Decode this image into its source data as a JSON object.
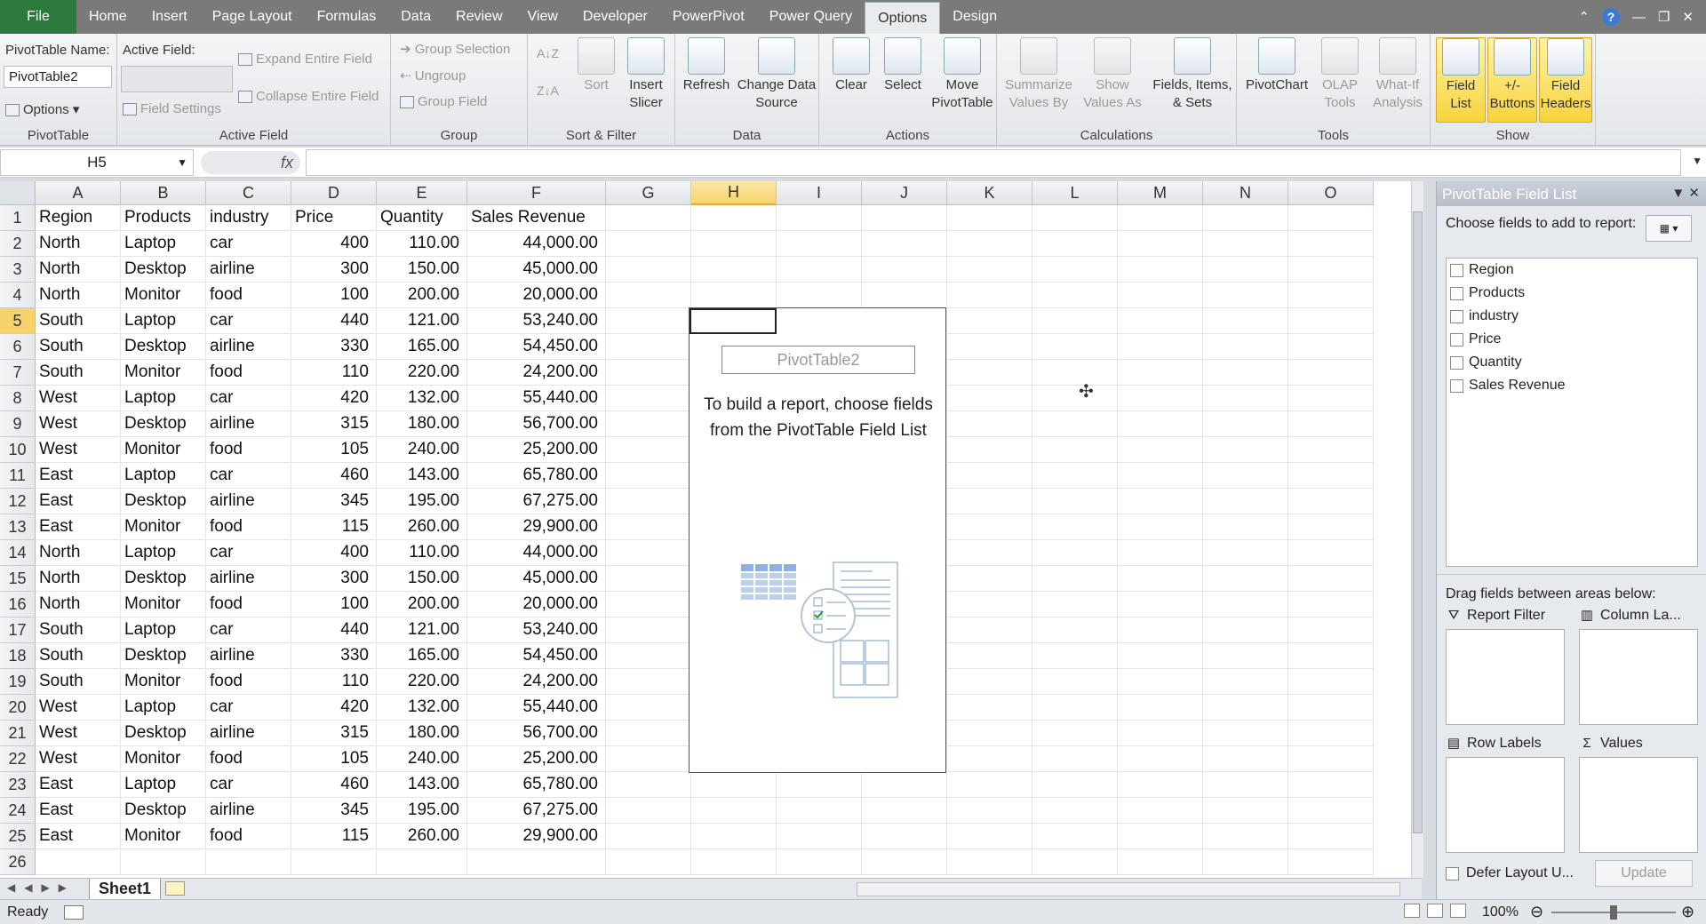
{
  "tabs": {
    "file": "File",
    "items": [
      "Home",
      "Insert",
      "Page Layout",
      "Formulas",
      "Data",
      "Review",
      "View",
      "Developer",
      "PowerPivot",
      "Power Query",
      "Options",
      "Design"
    ],
    "active": "Options"
  },
  "ribbon": {
    "pivottable": {
      "name_label": "PivotTable Name:",
      "name_value": "PivotTable2",
      "options_label": "Options",
      "group_label": "PivotTable"
    },
    "active_field": {
      "label": "Active Field:",
      "field_settings": "Field Settings",
      "expand": "Expand Entire Field",
      "collapse": "Collapse Entire Field",
      "group_label": "Active Field"
    },
    "group": {
      "group_selection": "Group Selection",
      "ungroup": "Ungroup",
      "group_field": "Group Field",
      "group_label": "Group"
    },
    "sort_filter": {
      "sort": "Sort",
      "insert_slicer": "Insert Slicer",
      "group_label": "Sort & Filter"
    },
    "data": {
      "refresh": "Refresh",
      "change_source": "Change Data Source",
      "group_label": "Data"
    },
    "actions": {
      "clear": "Clear",
      "select": "Select",
      "move": "Move PivotTable",
      "group_label": "Actions"
    },
    "calculations": {
      "summarize": "Summarize Values By",
      "show_values": "Show Values As",
      "fields_items": "Fields, Items, & Sets",
      "group_label": "Calculations"
    },
    "tools": {
      "pivotchart": "PivotChart",
      "olap": "OLAP Tools",
      "whatif": "What-If Analysis",
      "group_label": "Tools"
    },
    "show": {
      "field_list": "Field List",
      "buttons": "+/- Buttons",
      "headers": "Field Headers",
      "group_label": "Show"
    }
  },
  "formula_bar": {
    "name_box": "H5",
    "fx": "fx",
    "value": ""
  },
  "grid": {
    "columns": [
      "A",
      "B",
      "C",
      "D",
      "E",
      "F",
      "G",
      "H",
      "I",
      "J",
      "K",
      "L",
      "M",
      "N",
      "O"
    ],
    "selected_column": "H",
    "selected_row": 5,
    "header": [
      "Region",
      "Products",
      "industry",
      "Price",
      "Quantity",
      "Sales Revenue"
    ],
    "rows": [
      [
        "North",
        "Laptop",
        "car",
        "400",
        "110.00",
        "44,000.00"
      ],
      [
        "North",
        "Desktop",
        "airline",
        "300",
        "150.00",
        "45,000.00"
      ],
      [
        "North",
        "Monitor",
        "food",
        "100",
        "200.00",
        "20,000.00"
      ],
      [
        "South",
        "Laptop",
        "car",
        "440",
        "121.00",
        "53,240.00"
      ],
      [
        "South",
        "Desktop",
        "airline",
        "330",
        "165.00",
        "54,450.00"
      ],
      [
        "South",
        "Monitor",
        "food",
        "110",
        "220.00",
        "24,200.00"
      ],
      [
        "West",
        "Laptop",
        "car",
        "420",
        "132.00",
        "55,440.00"
      ],
      [
        "West",
        "Desktop",
        "airline",
        "315",
        "180.00",
        "56,700.00"
      ],
      [
        "West",
        "Monitor",
        "food",
        "105",
        "240.00",
        "25,200.00"
      ],
      [
        "East",
        "Laptop",
        "car",
        "460",
        "143.00",
        "65,780.00"
      ],
      [
        "East",
        "Desktop",
        "airline",
        "345",
        "195.00",
        "67,275.00"
      ],
      [
        "East",
        "Monitor",
        "food",
        "115",
        "260.00",
        "29,900.00"
      ],
      [
        "North",
        "Laptop",
        "car",
        "400",
        "110.00",
        "44,000.00"
      ],
      [
        "North",
        "Desktop",
        "airline",
        "300",
        "150.00",
        "45,000.00"
      ],
      [
        "North",
        "Monitor",
        "food",
        "100",
        "200.00",
        "20,000.00"
      ],
      [
        "South",
        "Laptop",
        "car",
        "440",
        "121.00",
        "53,240.00"
      ],
      [
        "South",
        "Desktop",
        "airline",
        "330",
        "165.00",
        "54,450.00"
      ],
      [
        "South",
        "Monitor",
        "food",
        "110",
        "220.00",
        "24,200.00"
      ],
      [
        "West",
        "Laptop",
        "car",
        "420",
        "132.00",
        "55,440.00"
      ],
      [
        "West",
        "Desktop",
        "airline",
        "315",
        "180.00",
        "56,700.00"
      ],
      [
        "West",
        "Monitor",
        "food",
        "105",
        "240.00",
        "25,200.00"
      ],
      [
        "East",
        "Laptop",
        "car",
        "460",
        "143.00",
        "65,780.00"
      ],
      [
        "East",
        "Desktop",
        "airline",
        "345",
        "195.00",
        "67,275.00"
      ],
      [
        "East",
        "Monitor",
        "food",
        "115",
        "260.00",
        "29,900.00"
      ]
    ],
    "numeric_columns": [
      3,
      4,
      5
    ]
  },
  "pivot_placeholder": {
    "name": "PivotTable2",
    "instructions": "To build a report, choose fields from the PivotTable Field List"
  },
  "sheet_tabs": {
    "active": "Sheet1"
  },
  "field_list": {
    "title": "PivotTable Field List",
    "choose_label": "Choose fields to add to report:",
    "fields": [
      "Region",
      "Products",
      "industry",
      "Price",
      "Quantity",
      "Sales Revenue"
    ],
    "drag_label": "Drag fields between areas below:",
    "areas": {
      "report_filter": "Report Filter",
      "column_labels": "Column La...",
      "row_labels": "Row Labels",
      "values": "Values"
    },
    "defer_label": "Defer Layout U...",
    "update_label": "Update"
  },
  "status_bar": {
    "ready": "Ready",
    "zoom": "100%"
  },
  "colors": {
    "file_tab": "#2c7a3d",
    "selection_header": "#f6d26b",
    "highlight_button": "#f8d33c"
  }
}
